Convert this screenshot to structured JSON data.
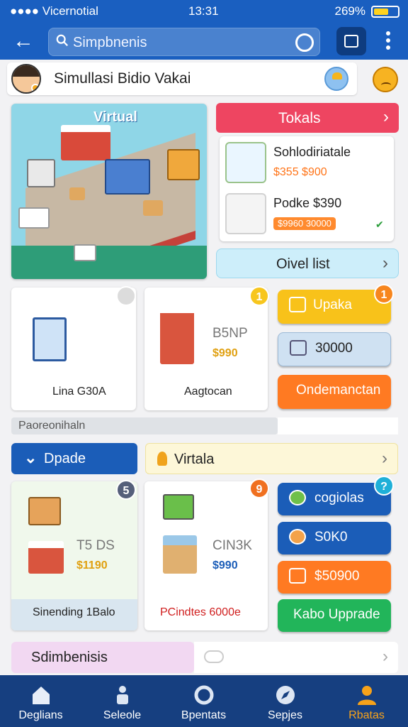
{
  "status_bar": {
    "left": "Vicernotial",
    "time": "13:31",
    "battery": "269%"
  },
  "search": {
    "placeholder": "Simpbnenis"
  },
  "header": {
    "title": "Simullasi Bidio Vakai"
  },
  "hero": {
    "label": "Virtual"
  },
  "tokals": {
    "title": "Tokals",
    "items": [
      {
        "name": "Sohlodiriatale",
        "price": "$355 $900"
      },
      {
        "name": "Podke $390",
        "price": "$9960 30000"
      }
    ],
    "order_list_label": "Oivel list"
  },
  "row2": {
    "card1": {
      "caption": "Lina G30A"
    },
    "card2": {
      "caption": "Aagtocan",
      "title": "B5NP",
      "price": "$990",
      "badge": "1"
    },
    "buttons": [
      {
        "label": "Upaka",
        "badge": "1"
      },
      {
        "label": "30000"
      },
      {
        "label": "Ondemanctan"
      }
    ],
    "progress_label": "Paoreonihaln"
  },
  "tabs": {
    "upgrade": "Dpade",
    "virtual": "Virtala"
  },
  "row3": {
    "card1": {
      "title": "T5 DS",
      "price": "$1190",
      "caption": "Sinending 1Balo",
      "badge": "5"
    },
    "card2": {
      "title": "CIN3K",
      "price": "$990",
      "caption": "PCindtes 6000e",
      "badge": "9"
    },
    "buttons": [
      {
        "label": "cogiolas",
        "badge": "?"
      },
      {
        "label": "S0K0"
      },
      {
        "label": "$50900"
      },
      {
        "label": "Kabo Upprade"
      }
    ]
  },
  "bottom_bar": {
    "label": "Sdimbenisis"
  },
  "nav": [
    {
      "label": "Deglians",
      "icon": "home-icon"
    },
    {
      "label": "Seleole",
      "icon": "figure-icon"
    },
    {
      "label": "Bpentats",
      "icon": "circle-icon"
    },
    {
      "label": "Sepjes",
      "icon": "compass-icon"
    },
    {
      "label": "Rbatas",
      "icon": "person-icon"
    }
  ],
  "colors": {
    "primary": "#1a5fc0",
    "accent": "#f6a21a",
    "red": "#ee4561",
    "green": "#22b55a",
    "orange": "#ff7a22"
  }
}
